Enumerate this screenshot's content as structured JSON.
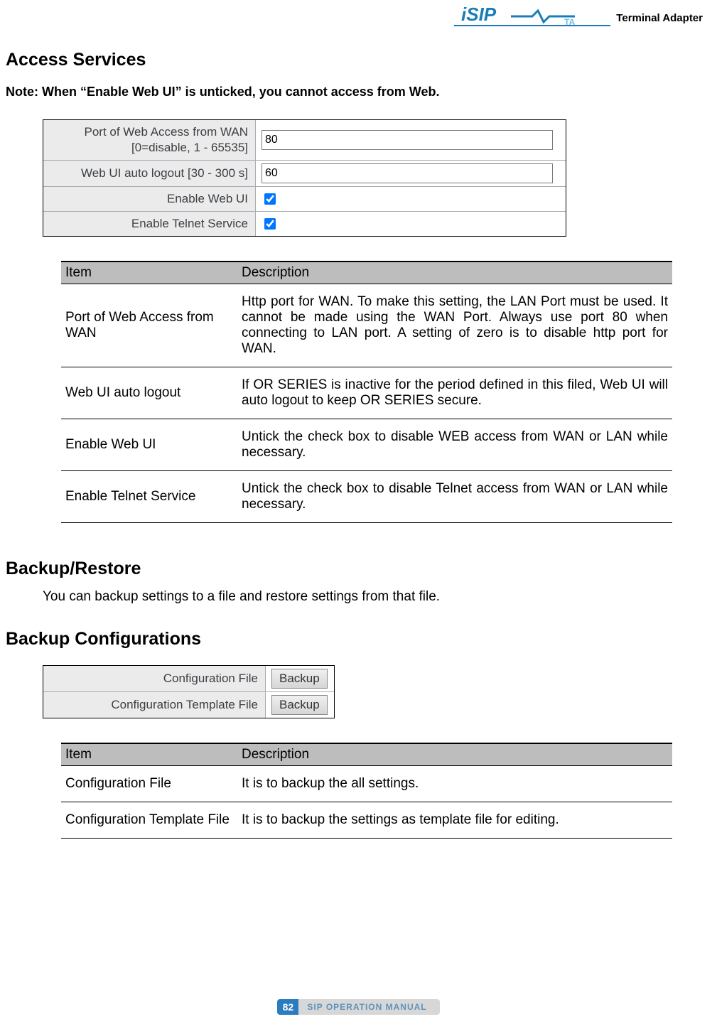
{
  "header": {
    "brand_tag": "Terminal Adapter"
  },
  "page": {
    "title_access": "Access Services",
    "note": "Note: When “Enable Web UI” is unticked, you cannot access from Web.",
    "title_backup": "Backup/Restore",
    "backup_intro": "You can backup settings to a file and restore settings from that file.",
    "title_backup_cfg": "Backup Configurations"
  },
  "access_form": {
    "rows": [
      {
        "label": "Port of Web Access from WAN\n[0=disable, 1 - 65535]",
        "type": "text",
        "value": "80"
      },
      {
        "label": "Web UI auto logout [30 - 300 s]",
        "type": "text",
        "value": "60"
      },
      {
        "label": "Enable Web UI",
        "type": "checkbox",
        "checked": true
      },
      {
        "label": "Enable Telnet Service",
        "type": "checkbox",
        "checked": true
      }
    ]
  },
  "access_table": {
    "headers": [
      "Item",
      "Description"
    ],
    "rows": [
      {
        "item": "Port of Web Access from WAN",
        "desc": "Http port for WAN. To make this setting, the LAN Port must be used. It cannot be made using the WAN Port. Always use port 80 when connecting to LAN port. A setting of zero is to disable http port for WAN."
      },
      {
        "item": "Web UI auto logout",
        "desc": "If OR SERIES is inactive for the period defined in this filed, Web UI will auto logout to keep OR SERIES secure."
      },
      {
        "item": "Enable Web UI",
        "desc": "Untick the check box to disable WEB access from WAN or LAN while necessary."
      },
      {
        "item": "Enable Telnet Service",
        "desc": "Untick the check box to disable Telnet access from WAN or LAN while necessary."
      }
    ]
  },
  "backup_form": {
    "rows": [
      {
        "label": "Configuration File",
        "button": "Backup"
      },
      {
        "label": "Configuration Template File",
        "button": "Backup"
      }
    ]
  },
  "backup_table": {
    "headers": [
      "Item",
      "Description"
    ],
    "rows": [
      {
        "item": "Configuration File",
        "desc": "It is to backup the all settings."
      },
      {
        "item": "Configuration Template File",
        "desc": "It is to backup the settings as template file for editing."
      }
    ]
  },
  "footer": {
    "page_number": "82",
    "manual_name": "SIP OPERATION MANUAL"
  }
}
